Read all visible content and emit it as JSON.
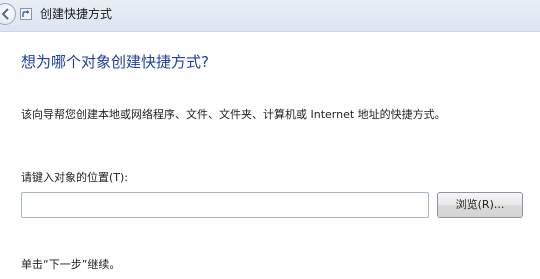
{
  "window": {
    "title": "创建快捷方式",
    "back_icon": "back-arrow-icon",
    "app_icon": "shortcut-icon"
  },
  "main": {
    "heading": "想为哪个对象创建快捷方式?",
    "intro": "该向导帮您创建本地或网络程序、文件、文件夹、计算机或 Internet 地址的快捷方式。",
    "location_label": "请键入对象的位置(T):",
    "location_value": "",
    "browse_label": "浏览(R)...",
    "footer_note": "单击“下一步”继续。"
  }
}
